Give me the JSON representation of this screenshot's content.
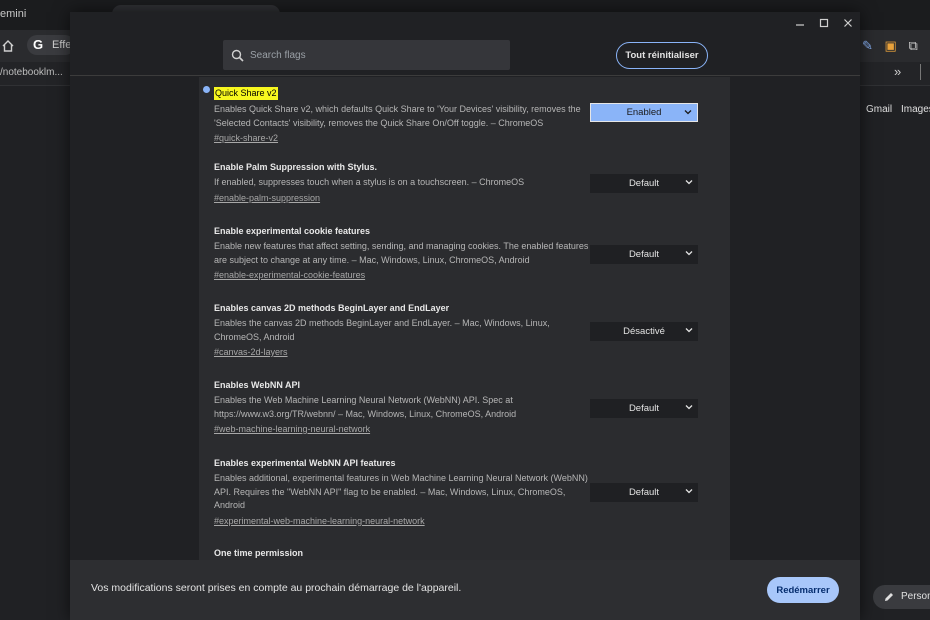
{
  "background": {
    "tab_label": "emini",
    "google_short": "Effe",
    "bookmark_label": "/notebooklm...",
    "gmail": "Gmail",
    "images": "Images",
    "persona": "Person"
  },
  "header": {
    "search_placeholder": "Search flags",
    "reset_label": "Tout réinitialiser"
  },
  "flags": [
    {
      "title": "Quick Share v2",
      "highlighted": true,
      "description": "Enables Quick Share v2, which defaults Quick Share to 'Your Devices' visibility, removes the 'Selected Contacts' visibility, removes the Quick Share On/Off toggle. – ChromeOS",
      "link": "#quick-share-v2",
      "value": "Enabled"
    },
    {
      "title": "Enable Palm Suppression with Stylus.",
      "description": "If enabled, suppresses touch when a stylus is on a touchscreen. – ChromeOS",
      "link": "#enable-palm-suppression",
      "value": "Default"
    },
    {
      "title": "Enable experimental cookie features",
      "description": "Enable new features that affect setting, sending, and managing cookies. The enabled features are subject to change at any time. – Mac, Windows, Linux, ChromeOS, Android",
      "link": "#enable-experimental-cookie-features",
      "value": "Default"
    },
    {
      "title": "Enables canvas 2D methods BeginLayer and EndLayer",
      "description": "Enables the canvas 2D methods BeginLayer and EndLayer. – Mac, Windows, Linux, ChromeOS, Android",
      "link": "#canvas-2d-layers",
      "value": "Désactivé"
    },
    {
      "title": "Enables WebNN API",
      "description": "Enables the Web Machine Learning Neural Network (WebNN) API. Spec at https://www.w3.org/TR/webnn/ – Mac, Windows, Linux, ChromeOS, Android",
      "link": "#web-machine-learning-neural-network",
      "value": "Default"
    },
    {
      "title": "Enables experimental WebNN API features",
      "description": "Enables additional, experimental features in Web Machine Learning Neural Network (WebNN) API. Requires the \"WebNN API\" flag to be enabled. – Mac, Windows, Linux, ChromeOS, Android",
      "link": "#experimental-web-machine-learning-neural-network",
      "value": "Default"
    },
    {
      "title": "One time permission"
    }
  ],
  "footer": {
    "message": "Vos modifications seront prises en compte au prochain démarrage de l'appareil.",
    "restart_label": "Redémarrer"
  },
  "colors": {
    "accent": "#8ab4f8",
    "highlight": "#f7f71f",
    "restart_bg": "#a8c7fa"
  }
}
